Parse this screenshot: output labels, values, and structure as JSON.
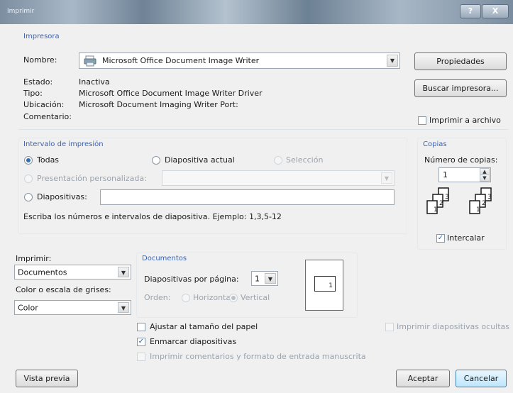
{
  "window": {
    "title": "Imprimir",
    "help": "?",
    "close": "X"
  },
  "printer": {
    "section_title": "Impresora",
    "name_label": "Nombre:",
    "name_value": "Microsoft Office Document Image Writer",
    "status_label": "Estado:",
    "status_value": "Inactiva",
    "type_label": "Tipo:",
    "type_value": "Microsoft Office Document Image Writer Driver",
    "location_label": "Ubicación:",
    "location_value": "Microsoft Document Imaging Writer Port:",
    "comment_label": "Comentario:",
    "properties_button": "Propiedades",
    "find_printer_button": "Buscar impresora...",
    "print_to_file": "Imprimir a archivo"
  },
  "print_range": {
    "section_title": "Intervalo de impresión",
    "all": "Todas",
    "current_slide": "Diapositiva actual",
    "selection": "Selección",
    "custom_show": "Presentación personalizada:",
    "slides": "Diapositivas:",
    "hint": "Escriba los números e intervalos de diapositiva. Ejemplo: 1,3,5-12"
  },
  "copies": {
    "section_title": "Copias",
    "count_label": "Número de copias:",
    "count_value": "1",
    "collate": "Intercalar"
  },
  "print_what": {
    "label": "Imprimir:",
    "value": "Documentos",
    "color_label": "Color o escala de grises:",
    "color_value": "Color"
  },
  "handouts": {
    "section_title": "Documentos",
    "slides_per_page_label": "Diapositivas por página:",
    "slides_per_page_value": "1",
    "order_label": "Orden:",
    "horizontal": "Horizontal",
    "vertical": "Vertical",
    "preview_number": "1"
  },
  "options": {
    "scale_to_fit": "Ajustar al tamaño del papel",
    "frame_slides": "Enmarcar diapositivas",
    "print_comments": "Imprimir comentarios y formato de entrada manuscrita",
    "print_hidden": "Imprimir diapositivas ocultas"
  },
  "footer": {
    "preview": "Vista previa",
    "ok": "Aceptar",
    "cancel": "Cancelar"
  }
}
